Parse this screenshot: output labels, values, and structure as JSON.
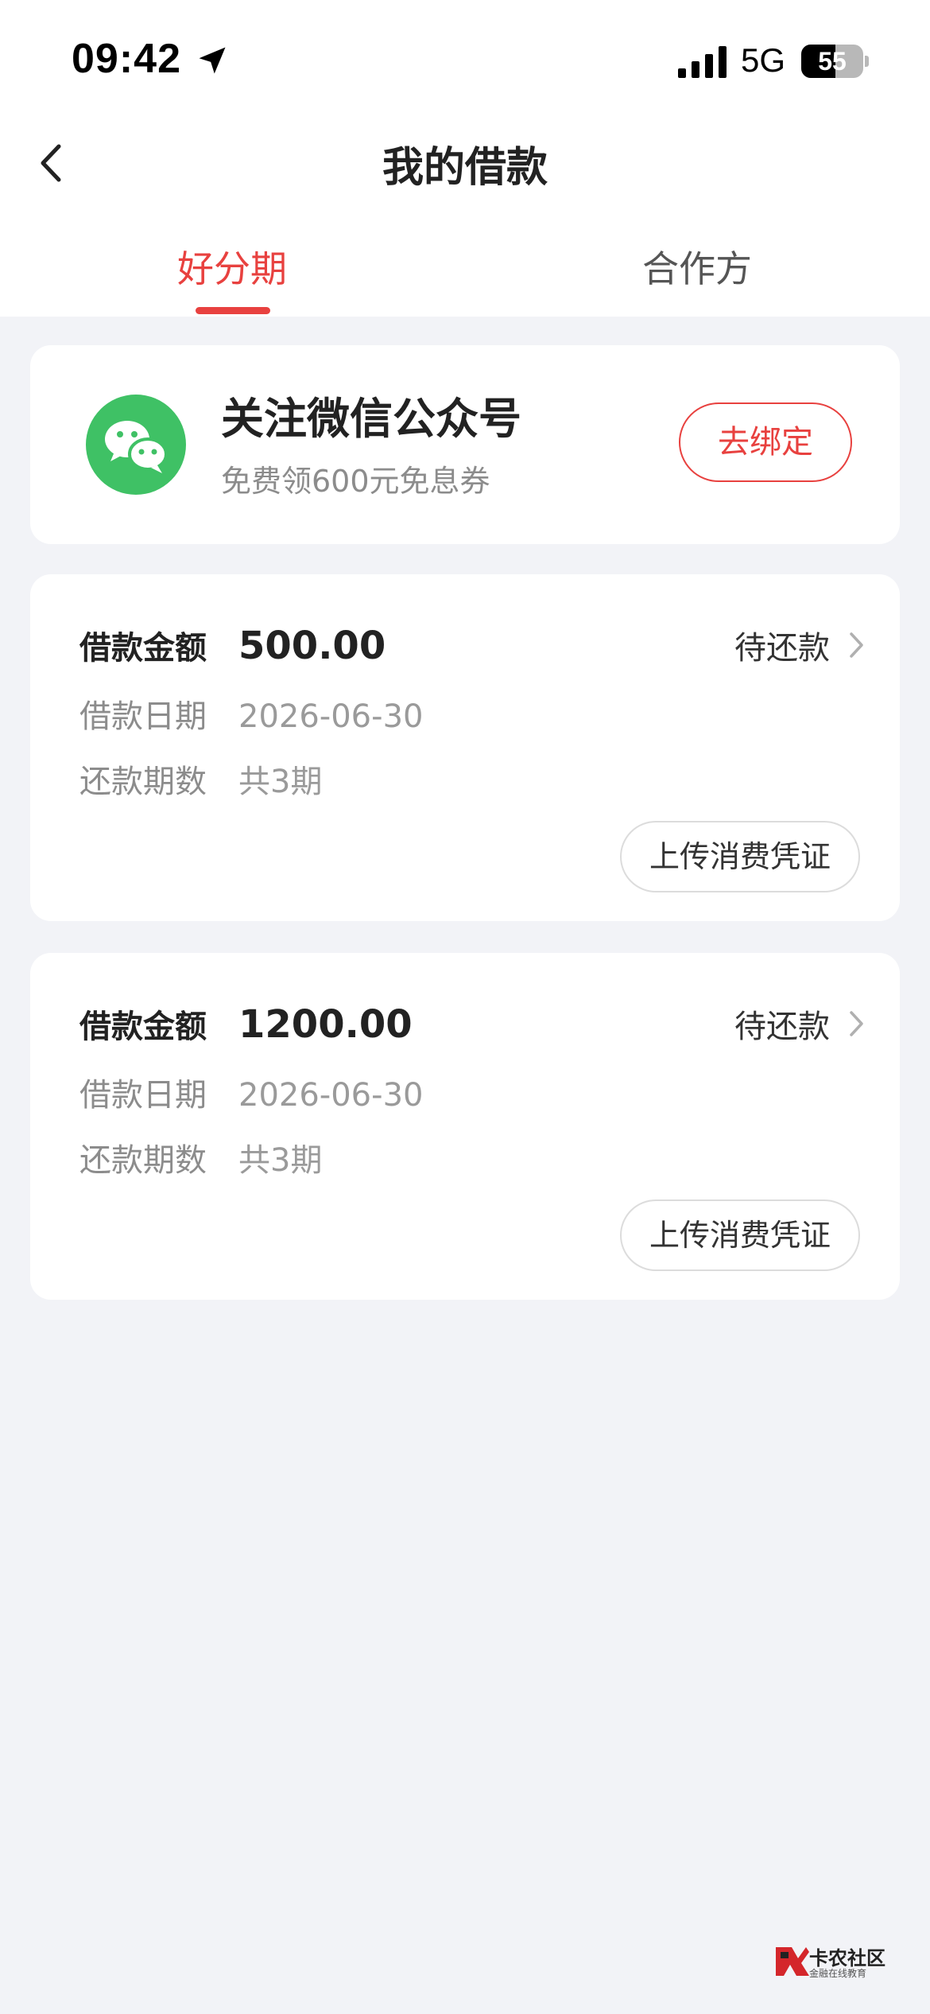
{
  "status_bar": {
    "time": "09:42",
    "network": "5G",
    "battery": "55",
    "battery_level_percent": 55,
    "icons": [
      "location-arrow-icon",
      "cellular-signal-icon",
      "battery-icon"
    ]
  },
  "header": {
    "title": "我的借款",
    "back_icon": "chevron-left-icon"
  },
  "tabs": [
    {
      "label": "好分期",
      "active": true
    },
    {
      "label": "合作方",
      "active": false
    }
  ],
  "wechat_promo": {
    "title": "关注微信公众号",
    "subtitle": "免费领600元免息券",
    "button_label": "去绑定",
    "icon": "wechat-icon",
    "brand_color": "#3fc165"
  },
  "loans": [
    {
      "amount_label": "借款金额",
      "amount": "500.00",
      "status": "待还款",
      "date_label": "借款日期",
      "date": "2026-06-30",
      "terms_label": "还款期数",
      "terms": "共3期",
      "upload_button": "上传消费凭证"
    },
    {
      "amount_label": "借款金额",
      "amount": "1200.00",
      "status": "待还款",
      "date_label": "借款日期",
      "date": "2026-06-30",
      "terms_label": "还款期数",
      "terms": "共3期",
      "upload_button": "上传消费凭证"
    }
  ],
  "watermark": {
    "name": "卡农社区",
    "tagline": "金融在线教育",
    "icon": "kanong-logo-icon"
  },
  "colors": {
    "accent": "#e8413f",
    "background": "#f2f3f7",
    "card": "#ffffff"
  }
}
